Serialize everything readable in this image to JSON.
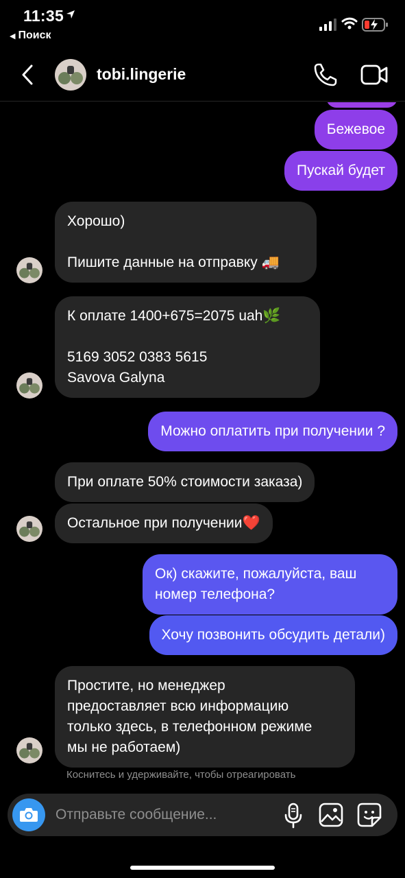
{
  "status_bar": {
    "time": "11:35",
    "back_app": "Поиск"
  },
  "header": {
    "username": "tobi.lingerie"
  },
  "messages": [
    {
      "from": "me",
      "text": "Бежевое"
    },
    {
      "from": "me",
      "text": "Пускай будет"
    },
    {
      "from": "them",
      "text": "Хорошо)\n\nПишите данные на отправку 🚚"
    },
    {
      "from": "them",
      "text": "К оплате 1400+675=2075 uah🌿\n\n5169 3052 0383 5615\nSavova Galyna"
    },
    {
      "from": "me",
      "text": "Можно оплатить при получении ?"
    },
    {
      "from": "them",
      "text": "При оплате 50% стоимости заказа)"
    },
    {
      "from": "them",
      "text": "Остальное при получении❤️"
    },
    {
      "from": "me",
      "text": "Ок) скажите, пожалуйста, ваш\nномер телефона?"
    },
    {
      "from": "me",
      "text": "Хочу позвонить обсудить детали)"
    },
    {
      "from": "them",
      "text": "Простите, но менеджер\nпредоставляет всю информацию\nтолько здесь, в телефонном режиме\nмы не работаем)"
    }
  ],
  "hint": "Коснитесь и удерживайте, чтобы отреагировать",
  "composer": {
    "placeholder": "Отправьте сообщение..."
  },
  "colors": {
    "incoming_bubble": "#262626",
    "outgoing_top": "#8a3ee8",
    "outgoing_bottom": "#4f5cf0",
    "camera_button": "#3797f0",
    "background": "#000000"
  }
}
